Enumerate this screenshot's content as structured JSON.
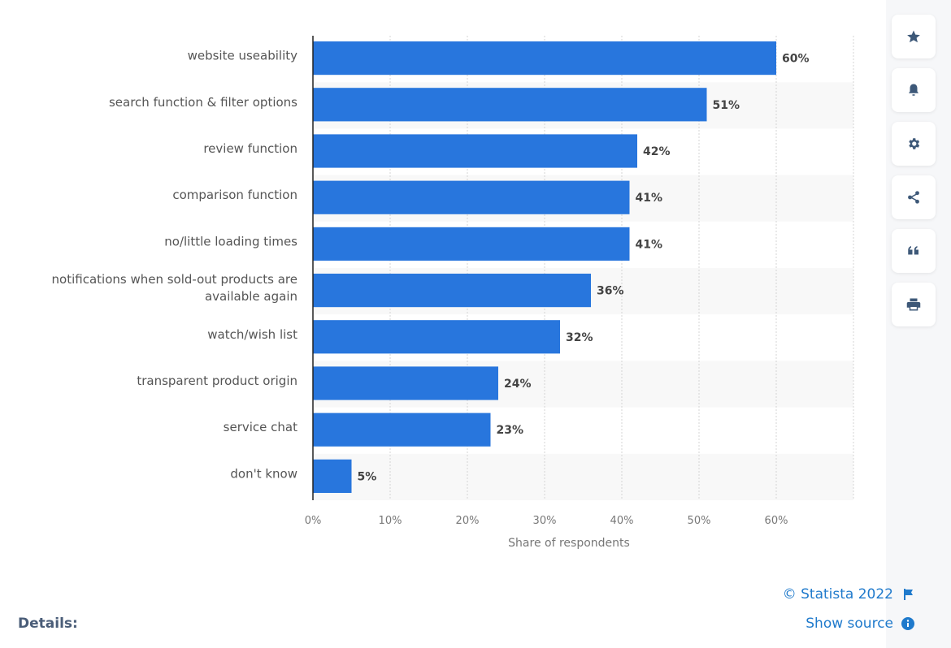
{
  "chart_data": {
    "type": "bar",
    "orientation": "horizontal",
    "categories": [
      "website useability",
      "search function & filter options",
      "review function",
      "comparison function",
      "no/little loading times",
      "notifications when sold-out products are available again",
      "watch/wish list",
      "transparent product origin",
      "service chat",
      "don't know"
    ],
    "category_lines": [
      [
        "website useability"
      ],
      [
        "search function & filter options"
      ],
      [
        "review function"
      ],
      [
        "comparison function"
      ],
      [
        "no/little loading times"
      ],
      [
        "notifications when sold-out products are",
        "available again"
      ],
      [
        "watch/wish list"
      ],
      [
        "transparent product origin"
      ],
      [
        "service chat"
      ],
      [
        "don't know"
      ]
    ],
    "values": [
      60,
      51,
      42,
      41,
      41,
      36,
      32,
      24,
      23,
      5
    ],
    "value_labels": [
      "60%",
      "51%",
      "42%",
      "41%",
      "41%",
      "36%",
      "32%",
      "24%",
      "23%",
      "5%"
    ],
    "xlabel": "Share of respondents",
    "ylabel": "",
    "xlim": [
      0,
      70
    ],
    "ticks": [
      0,
      10,
      20,
      30,
      40,
      50,
      60
    ],
    "tick_labels": [
      "0%",
      "10%",
      "20%",
      "30%",
      "40%",
      "50%",
      "60%"
    ],
    "grid": true,
    "legend": "none",
    "bar_color": "#2876dd"
  },
  "toolbar": {
    "buttons": [
      {
        "name": "favorite-button",
        "icon": "star-icon"
      },
      {
        "name": "notification-button",
        "icon": "bell-icon"
      },
      {
        "name": "settings-button",
        "icon": "gear-icon"
      },
      {
        "name": "share-button",
        "icon": "share-icon"
      },
      {
        "name": "cite-button",
        "icon": "quote-icon"
      },
      {
        "name": "print-button",
        "icon": "printer-icon"
      }
    ]
  },
  "footer": {
    "copyright": "© Statista 2022",
    "show_source": "Show source",
    "details_label": "Details:"
  },
  "colors": {
    "accent": "#1f7acc",
    "icon": "#3d5878"
  }
}
